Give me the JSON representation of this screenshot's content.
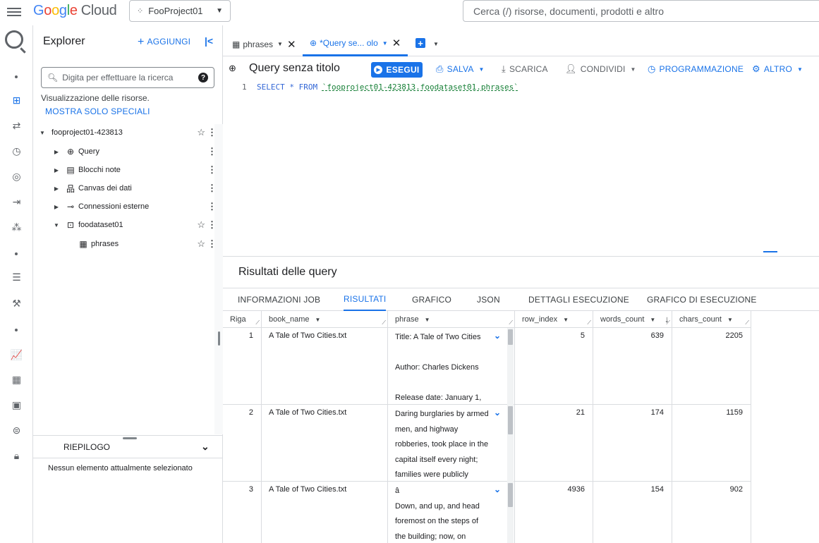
{
  "topbar": {
    "logo_parts": [
      "G",
      "o",
      "o",
      "g",
      "l",
      "e"
    ],
    "logo_cloud": "Cloud",
    "project_name": "FooProject01",
    "search_placeholder": "Cerca (/) risorse, documenti, prodotti e altro"
  },
  "rail": {
    "icons": [
      "bigquery-logo-icon",
      "dot-icon",
      "explorer-grid-icon",
      "transfer-icon",
      "clock-icon",
      "analytics-hub-icon",
      "pipeline-icon",
      "dataform-icon",
      "dot-icon",
      "list-icon",
      "wrench-icon",
      "dot-icon",
      "chart-icon",
      "dashboard-icon",
      "table-icon",
      "chat-icon",
      "lock-icon"
    ]
  },
  "explorer": {
    "title": "Explorer",
    "add_label": "AGGIUNGI",
    "search_placeholder": "Digita per effettuare la ricerca",
    "resource_view": "Visualizzazione delle risorse.",
    "starred_link": "MOSTRA SOLO SPECIALI",
    "tree": [
      {
        "label": "fooproject01-423813"
      },
      {
        "label": "Query"
      },
      {
        "label": "Blocchi note"
      },
      {
        "label": "Canvas dei dati"
      },
      {
        "label": "Connessioni esterne"
      },
      {
        "label": "foodataset01"
      },
      {
        "label": "phrases"
      }
    ],
    "summary_label": "RIEPILOGO",
    "summary_text": "Nessun elemento attualmente selezionato"
  },
  "tabs": [
    {
      "label": "phrases"
    },
    {
      "label": "*Query se... olo"
    }
  ],
  "toolbar": {
    "title": "Query senza titolo",
    "run": "ESEGUI",
    "save": "SALVA",
    "download": "SCARICA",
    "share": "CONDIVIDI",
    "schedule": "PROGRAMMAZIONE",
    "more": "ALTRO"
  },
  "editor": {
    "line_number": "1",
    "code_keywords": "SELECT * FROM ",
    "code_table": "`fooproject01-423813.foodataset01.phrases`"
  },
  "results": {
    "title": "Risultati delle query",
    "tabs": [
      "INFORMAZIONI JOB",
      "RISULTATI",
      "GRAFICO",
      "JSON",
      "DETTAGLI ESECUZIONE",
      "GRAFICO DI ESECUZIONE"
    ],
    "columns": [
      "Riga",
      "book_name",
      "phrase",
      "row_index",
      "words_count",
      "chars_count"
    ],
    "rows": [
      {
        "riga": "1",
        "book_name": "A Tale of Two Cities.txt",
        "phrase": "Title: A Tale of Two Cities\n\nAuthor: Charles Dickens\n\nRelease date: January 1,",
        "row_index": "5",
        "words_count": "639",
        "chars_count": "2205"
      },
      {
        "riga": "2",
        "book_name": "A Tale of Two Cities.txt",
        "phrase": "Daring burglaries by armed\nmen, and  highway\nrobberies, took place in the\ncapital itself every night;\nfamilies were publicly",
        "row_index": "21",
        "words_count": "174",
        "chars_count": "1159"
      },
      {
        "riga": "3",
        "book_name": "A Tale of Two Cities.txt",
        "phrase": "â\nDown, and up, and head\nforemost on the steps of\nthe building; now, on",
        "row_index": "4936",
        "words_count": "154",
        "chars_count": "902"
      }
    ]
  }
}
